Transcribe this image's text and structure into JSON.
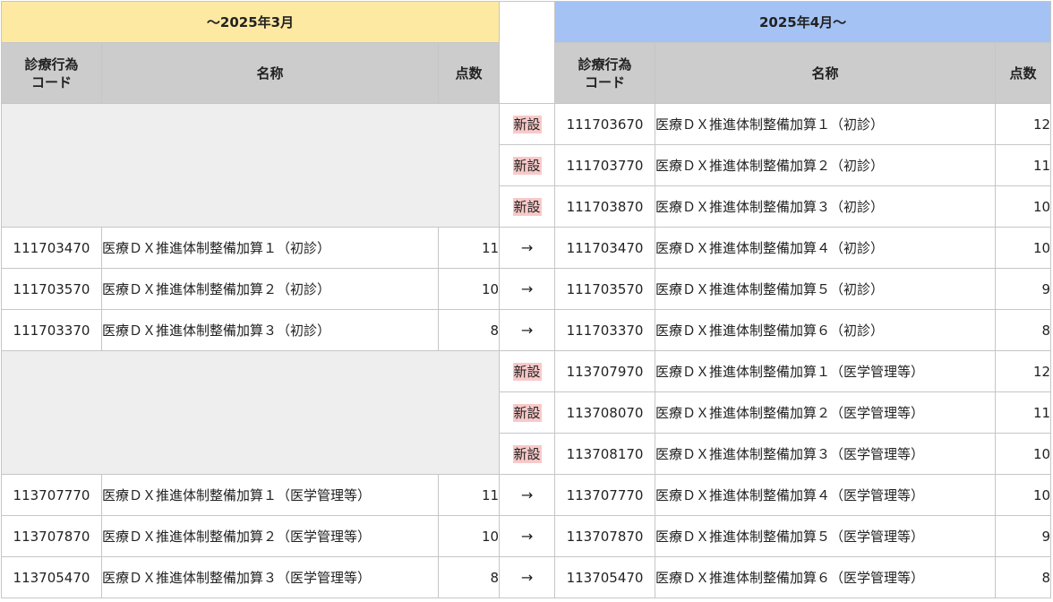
{
  "header": {
    "old_period": "～2025年3月",
    "new_period": "2025年4月～",
    "col_code_line1": "診療行為",
    "col_code_line2": "コード",
    "col_name": "名称",
    "col_points": "点数"
  },
  "marks": {
    "new": "新設",
    "arrow": "→"
  },
  "rows": [
    {
      "type": "new",
      "new": {
        "code": "111703670",
        "name": "医療ＤＸ推進体制整備加算１（初診）",
        "points": "12"
      }
    },
    {
      "type": "new",
      "new": {
        "code": "111703770",
        "name": "医療ＤＸ推進体制整備加算２（初診）",
        "points": "11"
      }
    },
    {
      "type": "new",
      "new": {
        "code": "111703870",
        "name": "医療ＤＸ推進体制整備加算３（初診）",
        "points": "10"
      }
    },
    {
      "type": "change",
      "old": {
        "code": "111703470",
        "name": "医療ＤＸ推進体制整備加算１（初診）",
        "points": "11"
      },
      "new": {
        "code": "111703470",
        "name": "医療ＤＸ推進体制整備加算４（初診）",
        "points": "10"
      }
    },
    {
      "type": "change",
      "old": {
        "code": "111703570",
        "name": "医療ＤＸ推進体制整備加算２（初診）",
        "points": "10"
      },
      "new": {
        "code": "111703570",
        "name": "医療ＤＸ推進体制整備加算５（初診）",
        "points": "9"
      }
    },
    {
      "type": "change",
      "old": {
        "code": "111703370",
        "name": "医療ＤＸ推進体制整備加算３（初診）",
        "points": "8"
      },
      "new": {
        "code": "111703370",
        "name": "医療ＤＸ推進体制整備加算６（初診）",
        "points": "8"
      }
    },
    {
      "type": "new",
      "new": {
        "code": "113707970",
        "name": "医療ＤＸ推進体制整備加算１（医学管理等）",
        "points": "12"
      }
    },
    {
      "type": "new",
      "new": {
        "code": "113708070",
        "name": "医療ＤＸ推進体制整備加算２（医学管理等）",
        "points": "11"
      }
    },
    {
      "type": "new",
      "new": {
        "code": "113708170",
        "name": "医療ＤＸ推進体制整備加算３（医学管理等）",
        "points": "10"
      }
    },
    {
      "type": "change",
      "old": {
        "code": "113707770",
        "name": "医療ＤＸ推進体制整備加算１（医学管理等）",
        "points": "11"
      },
      "new": {
        "code": "113707770",
        "name": "医療ＤＸ推進体制整備加算４（医学管理等）",
        "points": "10"
      }
    },
    {
      "type": "change",
      "old": {
        "code": "113707870",
        "name": "医療ＤＸ推進体制整備加算２（医学管理等）",
        "points": "10"
      },
      "new": {
        "code": "113707870",
        "name": "医療ＤＸ推進体制整備加算５（医学管理等）",
        "points": "9"
      }
    },
    {
      "type": "change",
      "old": {
        "code": "113705470",
        "name": "医療ＤＸ推進体制整備加算３（医学管理等）",
        "points": "8"
      },
      "new": {
        "code": "113705470",
        "name": "医療ＤＸ推進体制整備加算６（医学管理等）",
        "points": "8"
      }
    }
  ]
}
